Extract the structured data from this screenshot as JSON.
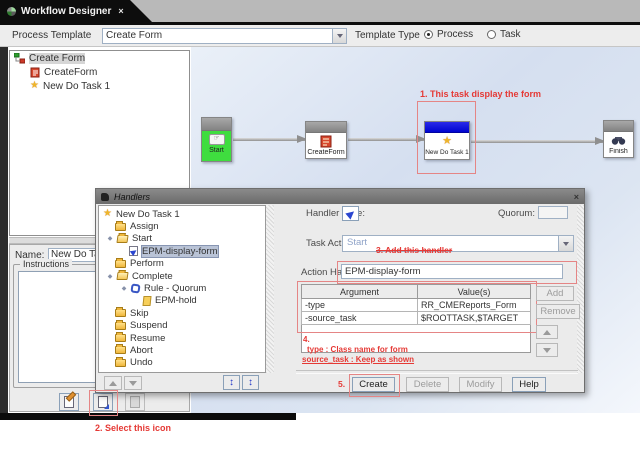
{
  "window": {
    "tab_title": "Workflow Designer",
    "tab_close": "×"
  },
  "toolbar": {
    "process_template_label": "Process Template",
    "process_template_value": "Create Form",
    "template_type_label": "Template Type",
    "radio_process_label": "Process",
    "radio_task_label": "Task"
  },
  "process_tree": {
    "root": "Create Form",
    "children": [
      "CreateForm",
      "New Do Task 1"
    ]
  },
  "canvas": {
    "annotation_1": "1. This task display the form",
    "nodes": [
      {
        "name": "start",
        "label": "Start"
      },
      {
        "name": "createform",
        "label": "CreateForm"
      },
      {
        "name": "new-do-task-1",
        "label": "New Do Task 1"
      },
      {
        "name": "finish",
        "label": "Finish"
      }
    ]
  },
  "task_panel": {
    "name_label": "Name:",
    "name_value": "New Do Tas",
    "instructions_label": "Instructions",
    "annotation_2": "2. Select this icon"
  },
  "dialog": {
    "title": "Handlers",
    "close": "×",
    "tree": {
      "items": [
        {
          "label": "New Do Task 1",
          "icon": "star-icon"
        },
        {
          "label": "Assign",
          "icon": "folder-icon"
        },
        {
          "label": "Start",
          "icon": "folder-open-icon"
        },
        {
          "label": "EPM-display-form",
          "icon": "handler-icon",
          "selected": true
        },
        {
          "label": "Perform",
          "icon": "folder-icon"
        },
        {
          "label": "Complete",
          "icon": "folder-open-icon"
        },
        {
          "label": "Rule - Quorum",
          "icon": "rule-icon"
        },
        {
          "label": "EPM-hold",
          "icon": "note-icon"
        },
        {
          "label": "Skip",
          "icon": "folder-icon"
        },
        {
          "label": "Suspend",
          "icon": "folder-icon"
        },
        {
          "label": "Resume",
          "icon": "folder-icon"
        },
        {
          "label": "Abort",
          "icon": "folder-icon"
        },
        {
          "label": "Undo",
          "icon": "folder-icon"
        }
      ]
    },
    "handler_type_label": "Handler Type:",
    "quorum_label": "Quorum:",
    "task_action_label": "Task Action:",
    "task_action_value": "Start",
    "annotation_3": "3. Add this handler",
    "action_handler_label": "Action Handler:",
    "action_handler_value": "EPM-display-form",
    "table": {
      "headers": [
        "Argument",
        "Value(s)"
      ],
      "rows": [
        [
          "-type",
          "RR_CMEReports_Form"
        ],
        [
          "-source_task",
          "$ROOTTASK,$TARGET"
        ]
      ]
    },
    "side_buttons": {
      "add": "Add",
      "remove": "Remove"
    },
    "annotation_4_num": "4.",
    "annotation_4_line1": "type : Class name for form",
    "annotation_4_line2": "source_task : Keep as shown",
    "annotation_5": "5.",
    "footer_buttons": {
      "create": "Create",
      "delete": "Delete",
      "modify": "Modify",
      "help": "Help"
    }
  },
  "colors": {
    "annotation_red": "#e53935",
    "node_header_blue": "#0004cf",
    "start_green": "#3fdd3f",
    "canvas_blue": "#d5dff0"
  }
}
